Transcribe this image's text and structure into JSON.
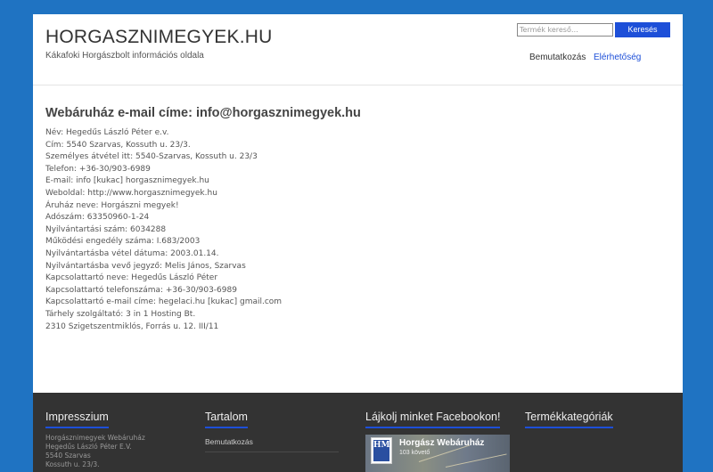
{
  "header": {
    "site_title": "HORGASZNIMEGYEK.HU",
    "site_description": "Kákafoki Horgászbolt információs oldala",
    "search": {
      "placeholder": "Termék kereső…",
      "button_label": "Keresés"
    },
    "nav": [
      {
        "label": "Bemutatkozás",
        "active": false
      },
      {
        "label": "Elérhetőség",
        "active": true
      }
    ]
  },
  "content": {
    "title": "Webáruház e-mail címe: info@horgasznimegyek.hu",
    "lines": [
      "Név: Hegedűs László Péter e.v.",
      "Cím: 5540 Szarvas, Kossuth u. 23/3.",
      "Személyes átvétel itt: 5540-Szarvas, Kossuth u. 23/3",
      "Telefon: +36-30/903-6989",
      "E-mail: info [kukac] horgasznimegyek.hu",
      "Weboldal: http://www.horgasznimegyek.hu",
      "Áruház neve: Horgászni megyek!",
      "Adószám: 63350960-1-24",
      "Nyilvántartási szám: 6034288",
      "Működési engedély száma: I.683/2003",
      "Nyilvántartásba vétel dátuma: 2003.01.14.",
      "Nyilvántartásba vevő jegyző: Melis János, Szarvas",
      "Kapcsolattartó neve: Hegedűs László Péter",
      "Kapcsolattartó telefonszáma: +36-30/903-6989",
      "Kapcsolattartó e-mail címe: hegelaci.hu [kukac] gmail.com",
      "Tárhely szolgáltató: 3 in 1 Hosting Bt.",
      "2310 Szigetszentmiklós, Forrás u. 12. III/11"
    ]
  },
  "footer": {
    "columns": [
      {
        "title": "Impresszium"
      },
      {
        "title": "Tartalom"
      },
      {
        "title": "Lájkolj minket Facebookon!"
      },
      {
        "title": "Termékkategóriák"
      }
    ],
    "impresszum_lines": [
      "Horgásznimegyek Webáruház",
      "Hegedűs László Péter E.V.",
      "5540 Szarvas",
      "Kossuth u. 23/3."
    ],
    "tartalom_links": [
      "Bemutatkozás"
    ],
    "facebook": {
      "page_name": "Horgász Webáruház",
      "followers": "103 követő",
      "logo_text": "HM"
    }
  },
  "colors": {
    "background": "#1f73c2",
    "accent": "#1d4fd8",
    "footer": "#333333"
  }
}
